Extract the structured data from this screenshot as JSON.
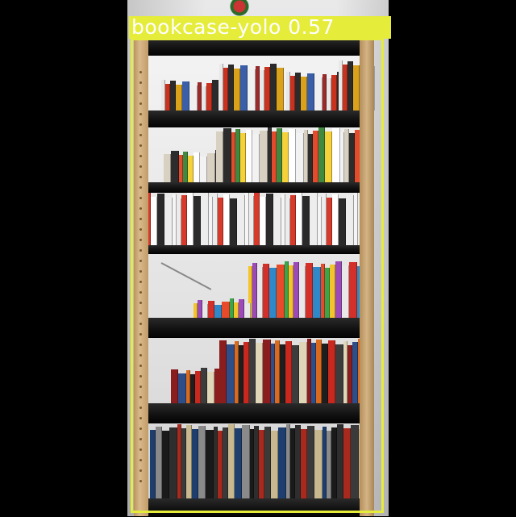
{
  "image": {
    "subject": "bookcase",
    "detection": {
      "label": "bookcase-yolo 0.57",
      "box_color": "#e5ec3a"
    }
  },
  "colors": {
    "background": "#000000",
    "frame_wood": "#c9a674",
    "shelf": "#111111",
    "wall": "#e0e0e2"
  }
}
